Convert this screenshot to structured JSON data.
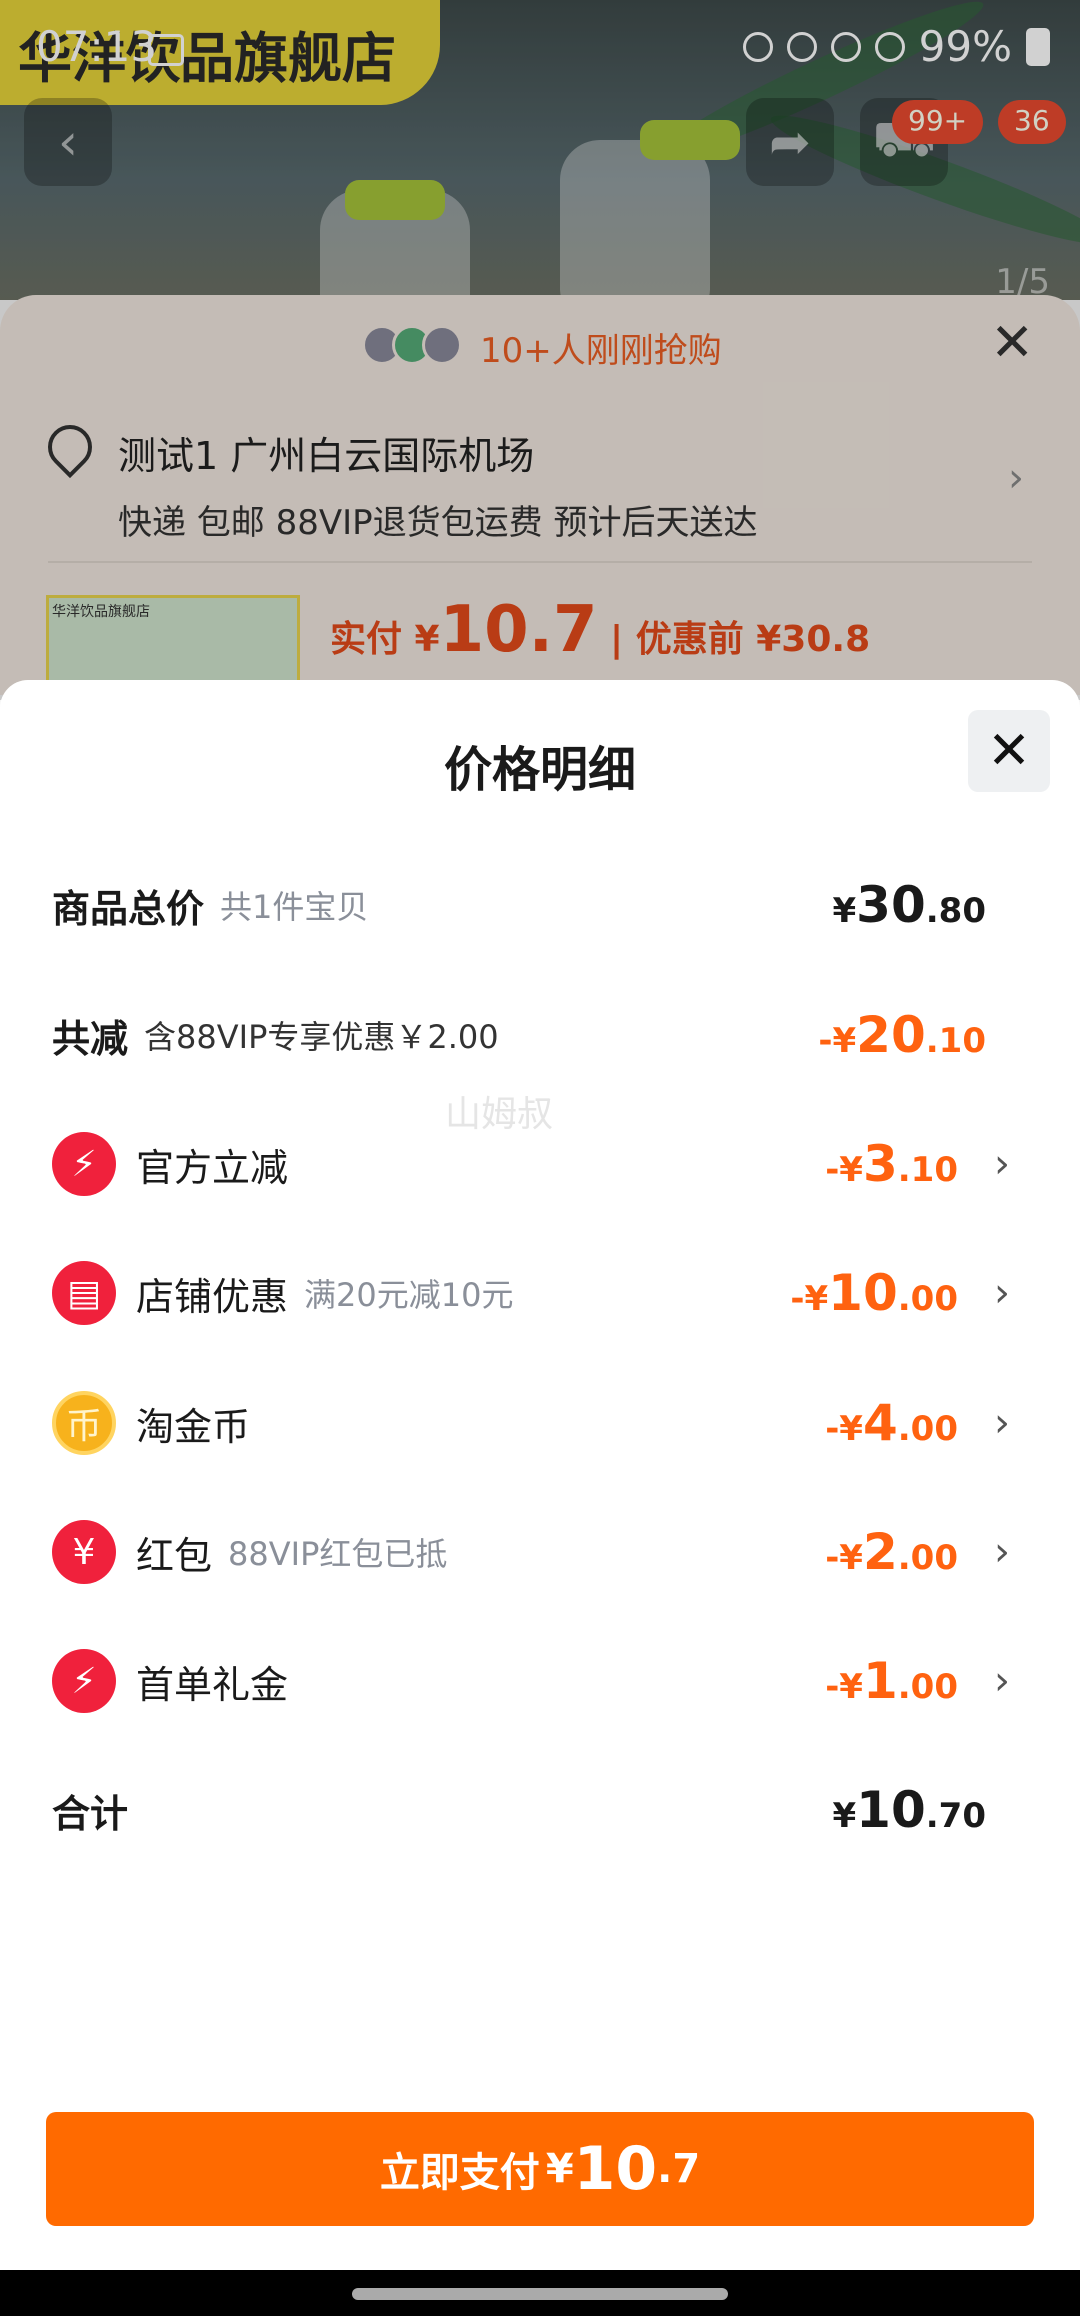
{
  "status_bar": {
    "time": "07:13",
    "battery": "99%"
  },
  "background": {
    "store_name": "华洋饮品旗舰店",
    "cart_badge": "99+",
    "msg_badge": "36",
    "pager": "1/5"
  },
  "order_sheet": {
    "promo": "10+人刚刚抢购",
    "address": "测试1 广州白云国际机场",
    "shipping": "快递 包邮 88VIP退货包运费 预计后天送达",
    "thumb_store": "华洋饮品旗舰店",
    "pay_label": "实付 ¥",
    "pay_value": "10.7",
    "orig_label": "| 优惠前 ¥30.8"
  },
  "modal": {
    "title": "价格明细",
    "total_goods": {
      "label": "商品总价",
      "sub": "共1件宝贝",
      "sym": "¥",
      "int": "30",
      "dec": ".80"
    },
    "total_discount": {
      "label": "共减",
      "sub": "含88VIP专享优惠￥2.00",
      "sym": "-¥",
      "int": "20",
      "dec": ".10"
    },
    "items": [
      {
        "label": "官方立减",
        "sub": "",
        "sym": "-¥",
        "int": "3",
        "dec": ".10",
        "icon": "lightning-icon"
      },
      {
        "label": "店铺优惠",
        "sub": "满20元减10元",
        "sym": "-¥",
        "int": "10",
        "dec": ".00",
        "icon": "store-icon"
      },
      {
        "label": "淘金币",
        "sub": "",
        "sym": "-¥",
        "int": "4",
        "dec": ".00",
        "icon": "coin-icon"
      },
      {
        "label": "红包",
        "sub": "88VIP红包已抵",
        "sym": "-¥",
        "int": "2",
        "dec": ".00",
        "icon": "red-packet-icon"
      },
      {
        "label": "首单礼金",
        "sub": "",
        "sym": "-¥",
        "int": "1",
        "dec": ".00",
        "icon": "lightning-icon"
      }
    ],
    "sum": {
      "label": "合计",
      "sym": "¥",
      "int": "10",
      "dec": ".70"
    },
    "watermark": "山姆叔"
  },
  "pay_button": {
    "label": "立即支付",
    "sym": "¥",
    "int": "10",
    "dec": ".7"
  },
  "colors": {
    "accent": "#ff6a00",
    "discount": "#ff6210",
    "icon_red": "#f0213c",
    "coin": "#f7b21c"
  }
}
